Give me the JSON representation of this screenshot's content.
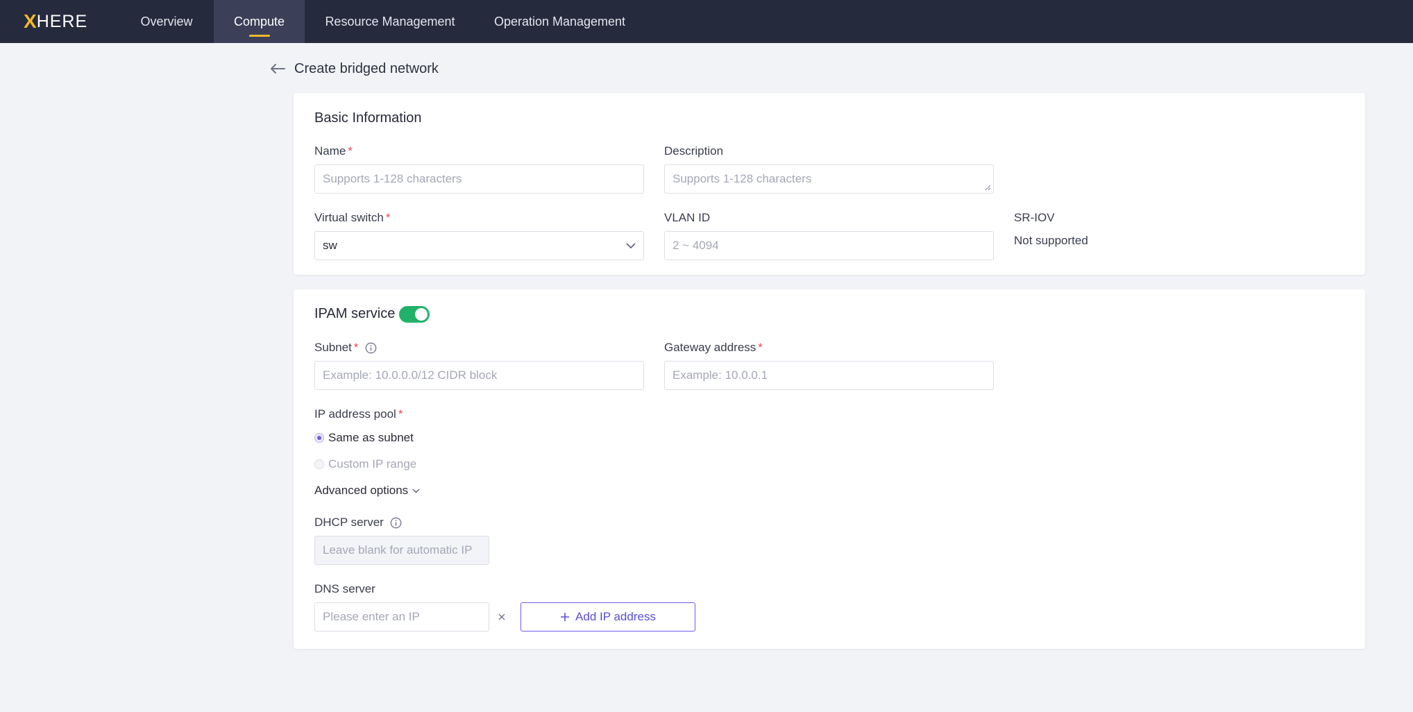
{
  "app": {
    "logo_mark": "X",
    "logo_text": "HERE",
    "accent_color": "#f5b928",
    "nav": [
      {
        "label": "Overview",
        "active": false
      },
      {
        "label": "Compute",
        "active": true
      },
      {
        "label": "Resource Management",
        "active": false
      },
      {
        "label": "Operation Management",
        "active": false
      }
    ]
  },
  "page": {
    "title": "Create bridged network",
    "back_icon": "arrow-left-icon"
  },
  "basic": {
    "title": "Basic Information",
    "name_label": "Name",
    "name_placeholder": "Supports 1-128 characters",
    "description_label": "Description",
    "description_placeholder": "Supports 1-128 characters",
    "switch_label": "Virtual switch",
    "switch_value": "sw",
    "vlan_label": "VLAN ID",
    "vlan_placeholder": "2 ~ 4094",
    "sriov_label": "SR-IOV",
    "sriov_value": "Not supported",
    "required_mark": "*"
  },
  "ipam": {
    "title": "IPAM service",
    "enabled": true,
    "toggle_color": "#21b26a",
    "subnet_label": "Subnet",
    "subnet_placeholder": "Example: 10.0.0.0/12 CIDR block",
    "gateway_label": "Gateway address",
    "gateway_placeholder": "Example: 10.0.0.1",
    "pool_label": "IP address pool",
    "pool_options": [
      {
        "label": "Same as subnet",
        "checked": true,
        "disabled": false
      },
      {
        "label": "Custom IP range",
        "checked": false,
        "disabled": true
      }
    ],
    "advanced_label": "Advanced options",
    "dhcp_label": "DHCP server",
    "dhcp_placeholder": "Leave blank for automatic IP",
    "dns_label": "DNS server",
    "dns_placeholder": "Please enter an IP",
    "add_ip_label": "Add IP address",
    "button_color": "#6b5ce7"
  }
}
